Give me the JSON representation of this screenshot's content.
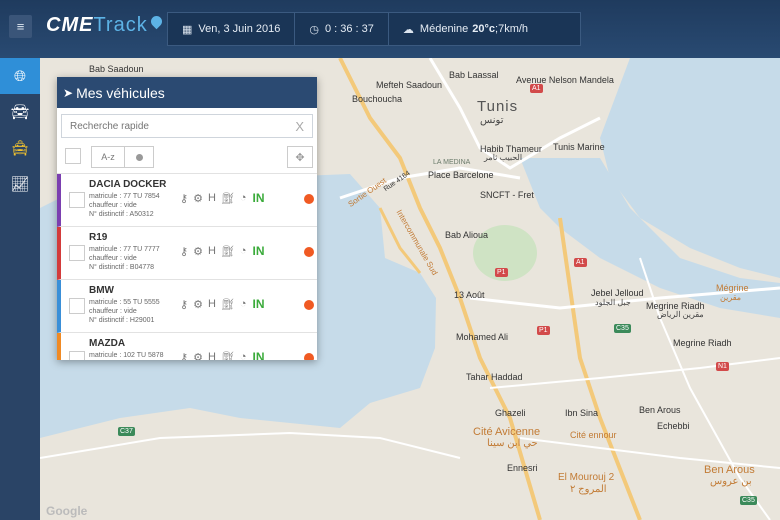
{
  "topbar": {
    "menu_icon": "hamburger-icon",
    "logo_cme": "CME",
    "logo_track": "Track",
    "date": "Ven, 3 Juin 2016",
    "time": "0 : 36 : 37",
    "weather_city": "Médenine",
    "weather_temp": "20°c",
    "weather_wind": ";7km/h"
  },
  "nav": {
    "items": [
      "globe-icon",
      "car-icon",
      "taxi-icon",
      "chart-line-icon"
    ],
    "active": "globe-icon",
    "accent": "#2f8fd8"
  },
  "panel": {
    "title": "Mes véhicules",
    "search_placeholder": "Recherche rapide",
    "clear": "X",
    "sort_az": "A-z"
  },
  "vehicles": [
    {
      "name": "DACIA DOCKER",
      "matricule": "matricule : 77 TU 7854",
      "chauffeur": "chauffeur : vide",
      "distinctif": "N° distinctif : A50312",
      "status": "IN",
      "color": "#7b3fb0"
    },
    {
      "name": "R19",
      "matricule": "matricule : 77 TU 7777",
      "chauffeur": "chauffeur : vide",
      "distinctif": "N° distinctif : B04778",
      "status": "IN",
      "color": "#d33b3b"
    },
    {
      "name": "BMW",
      "matricule": "matricule : 55 TU 5555",
      "chauffeur": "chauffeur : vide",
      "distinctif": "N° distinctif : H29001",
      "status": "IN",
      "color": "#3a8fd8"
    },
    {
      "name": "MAZDA",
      "matricule": "matricule : 102 TU 5878",
      "chauffeur": "",
      "distinctif": "",
      "status": "IN",
      "color": "#f08a24"
    }
  ],
  "map": {
    "labels": {
      "bab_saadoun": "Bab Saadoun",
      "bab_laassal": "Bab Laassal",
      "mefteh": "Mefteh Saadoun",
      "bouchoucha": "Bouchoucha",
      "nelson": "Avenue Nelson Mandela",
      "tunis": "Tunis",
      "tunis_ar": "تونس",
      "habib": "Habib Thameur",
      "habib_ar": "الحبيب ثامر",
      "tunis_marine": "Tunis Marine",
      "la_medina": "LA MEDINA",
      "place_barcelone": "Place Barcelone",
      "sncft": "SNCFT - Fret",
      "bab_alioua": "Bab Alioua",
      "treize_aout": "13 Août",
      "jebel_jeloud": "Jebel Jelloud",
      "jebel_jeloud_ar": "جبل الجلود",
      "megrine_riadh": "Megrine Riadh",
      "megrine_riadh_ar": "مقرين الرياض",
      "megrine": "Mégrine",
      "megrine_ar": "مقرين",
      "mohamed_ali": "Mohamed Ali",
      "tahar_haddad": "Tahar Haddad",
      "ghazeli": "Ghazeli",
      "ibn_sina": "Ibn Sina",
      "ben_arous_st": "Ben Arous",
      "echebbi": "Echebbi",
      "cite_avicenne": "Cité Avicenne",
      "cite_avicenne_ar": "حي ابن سينا",
      "cite_ennour": "Cité ennour",
      "ennesri": "Ennesri",
      "el_mourouj": "El Mourouj 2",
      "el_mourouj_ar": "المروج ٢",
      "ben_arous": "Ben Arous",
      "ben_arous_ar": "بن عروس",
      "megrine_riadh_st": "Megrine Riadh",
      "rue_4164": "Rue 4164",
      "sortie_ouest": "Sortie Ouest",
      "intercommunale": "Intercommunale Sud"
    },
    "badges": {
      "a1": "A1",
      "p1": "P1",
      "n1": "N1",
      "c35": "C35",
      "c37": "C37"
    },
    "attribution": "Google",
    "water_color": "#c6dbe9",
    "land_color": "#e9e5dc"
  }
}
